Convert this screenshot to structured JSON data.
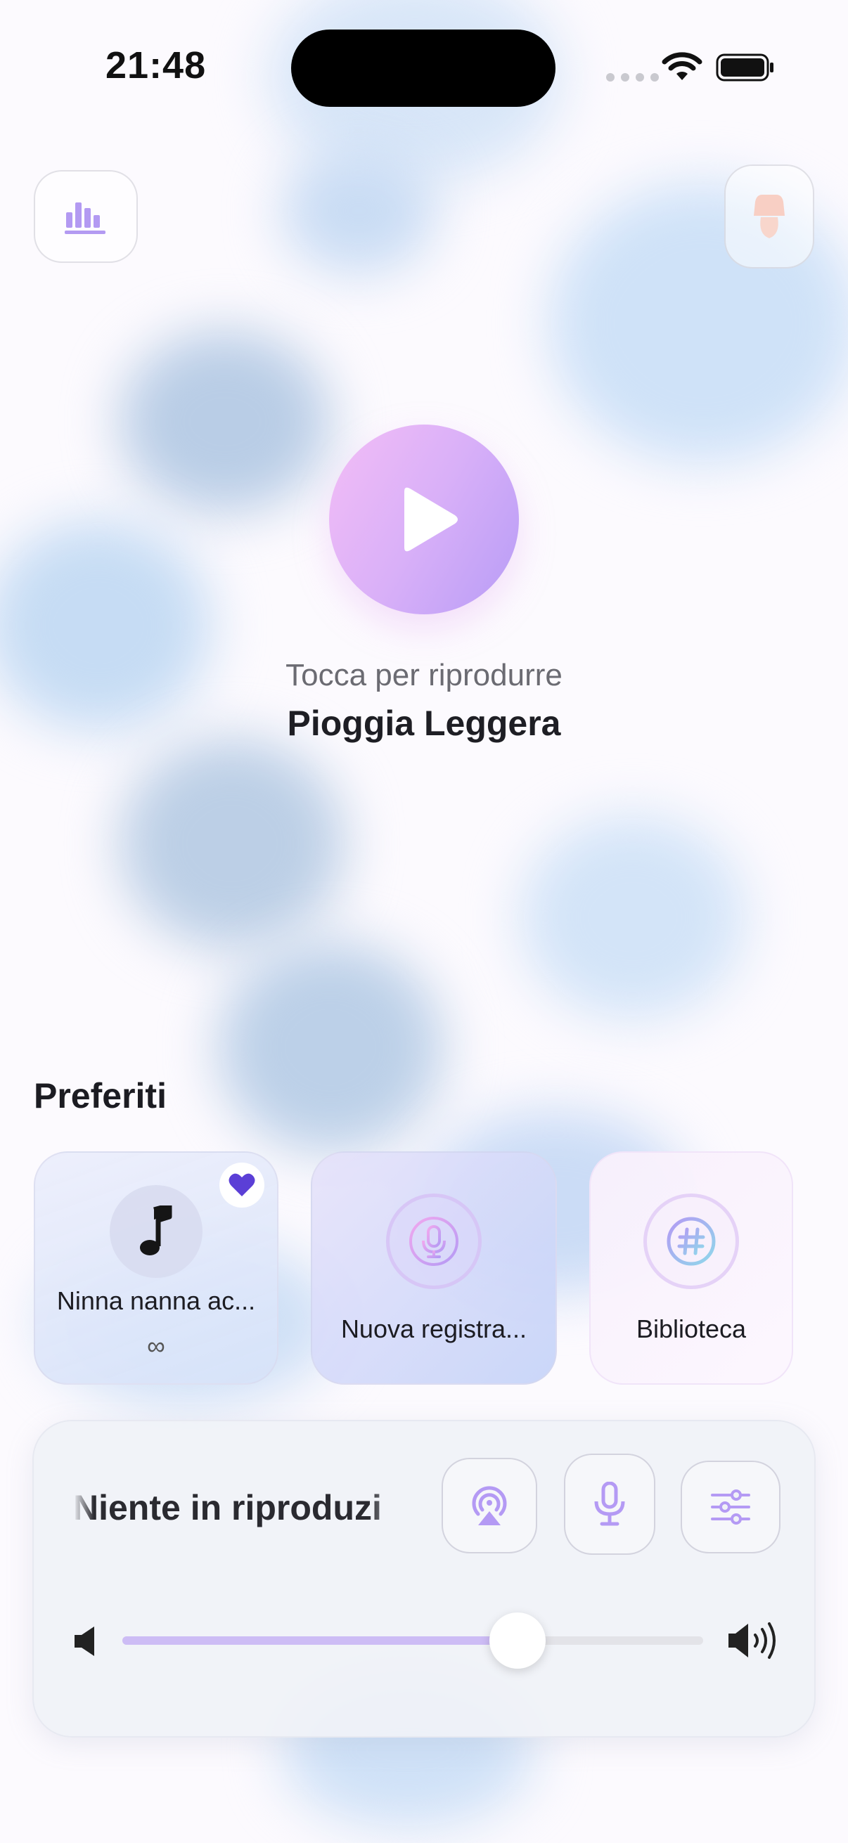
{
  "status_bar": {
    "time": "21:48",
    "icons": [
      "cellular-signal-icon",
      "wifi-icon",
      "battery-icon"
    ]
  },
  "top_bar": {
    "left_icon": "bar-chart-icon",
    "right_icon": "night-lamp-icon"
  },
  "hero": {
    "play_icon": "play-icon",
    "hint": "Tocca per riprodurre",
    "title": "Pioggia Leggera"
  },
  "favorites": {
    "title": "Preferiti",
    "items": [
      {
        "label": "Ninna nanna ac...",
        "sub": "∞",
        "icon": "music-note-icon",
        "favorite": true
      },
      {
        "label": "Nuova registra...",
        "icon": "microphone-icon"
      },
      {
        "label": "Biblioteca",
        "icon": "hashtag-icon"
      }
    ]
  },
  "player": {
    "now_playing": "Niente in riproduzi",
    "buttons": [
      "airplay-icon",
      "microphone-icon",
      "sliders-icon"
    ],
    "volume": 0.68
  },
  "colors": {
    "accent": "#a98cf0",
    "play_gradient_start": "#f3bdf6",
    "play_gradient_end": "#b79cf6",
    "heart": "#5b3fd6"
  }
}
